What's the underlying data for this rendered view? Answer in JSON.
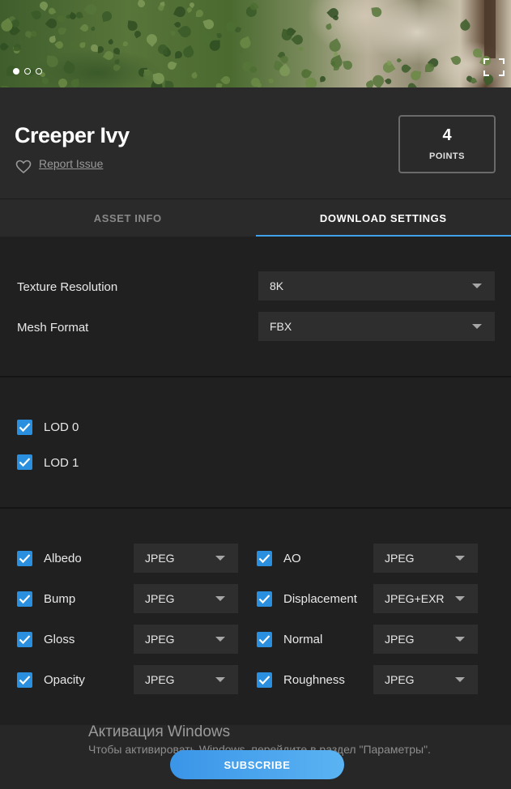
{
  "hero": {
    "carousel_dots": 3,
    "active_dot": 0,
    "fullscreen_icon": "fullscreen-icon"
  },
  "asset": {
    "title": "Creeper Ivy",
    "report_label": "Report Issue",
    "favorite_icon": "heart-icon",
    "points_value": "4",
    "points_label": "POINTS"
  },
  "tabs": [
    {
      "label": "ASSET INFO",
      "active": false
    },
    {
      "label": "DOWNLOAD SETTINGS",
      "active": true
    }
  ],
  "settings": {
    "texture_resolution": {
      "label": "Texture Resolution",
      "value": "8K"
    },
    "mesh_format": {
      "label": "Mesh Format",
      "value": "FBX"
    }
  },
  "lods": [
    {
      "label": "LOD 0",
      "checked": true
    },
    {
      "label": "LOD 1",
      "checked": true
    }
  ],
  "maps": [
    {
      "label": "Albedo",
      "format": "JPEG",
      "checked": true
    },
    {
      "label": "AO",
      "format": "JPEG",
      "checked": true
    },
    {
      "label": "Bump",
      "format": "JPEG",
      "checked": true
    },
    {
      "label": "Displacement",
      "format": "JPEG+EXR",
      "checked": true
    },
    {
      "label": "Gloss",
      "format": "JPEG",
      "checked": true
    },
    {
      "label": "Normal",
      "format": "JPEG",
      "checked": true
    },
    {
      "label": "Opacity",
      "format": "JPEG",
      "checked": true
    },
    {
      "label": "Roughness",
      "format": "JPEG",
      "checked": true
    }
  ],
  "overlay": {
    "windows_title": "Активация Windows",
    "windows_sub": "Чтобы активировать Windows, перейдите в раздел \"Параметры\".",
    "subscribe_label": "SUBSCRIBE"
  },
  "colors": {
    "accent": "#3fa2ea",
    "checkbox": "#2b8fe0",
    "panel": "#2a2a2a",
    "background": "#202020"
  }
}
